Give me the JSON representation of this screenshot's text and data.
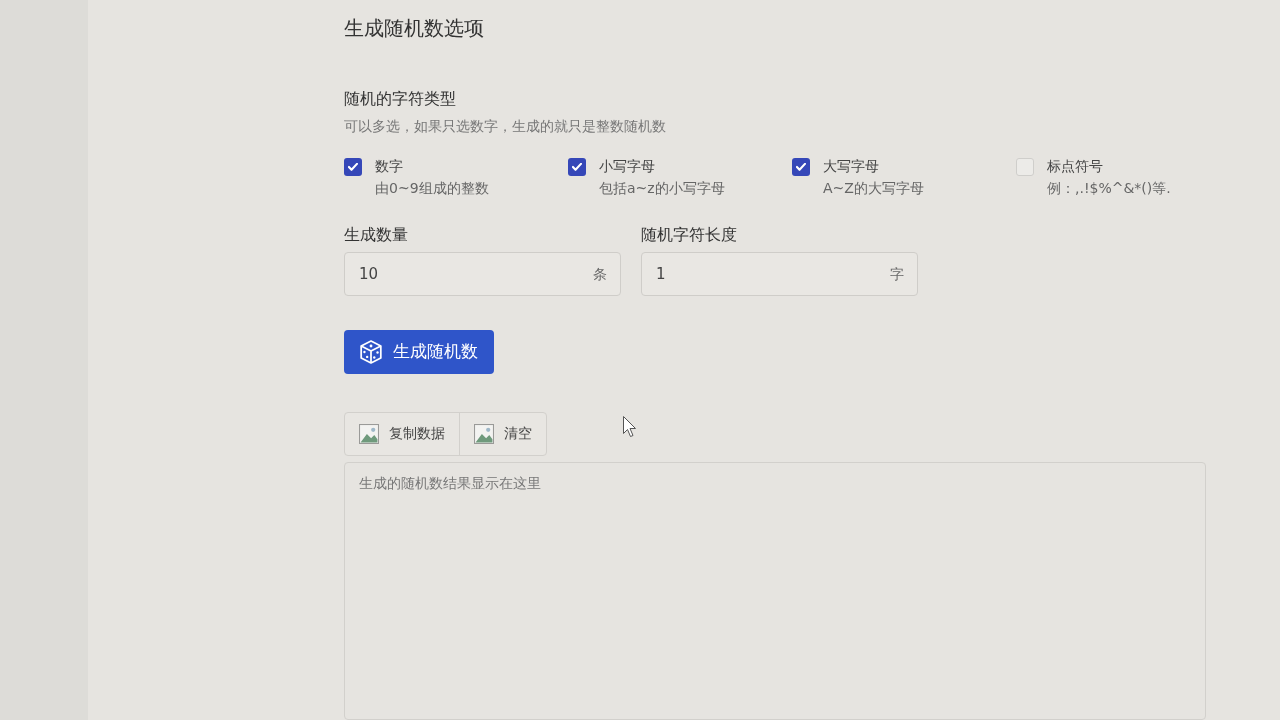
{
  "page": {
    "title": "生成随机数选项"
  },
  "char_types": {
    "label": "随机的字符类型",
    "hint": "可以多选，如果只选数字，生成的就只是整数随机数",
    "options": [
      {
        "label": "数字",
        "description": "由0~9组成的整数",
        "checked": true
      },
      {
        "label": "小写字母",
        "description": "包括a~z的小写字母",
        "checked": true
      },
      {
        "label": "大写字母",
        "description": "A~Z的大写字母",
        "checked": true
      },
      {
        "label": "标点符号",
        "description": "例：,.!$%^&*()等.",
        "checked": false
      }
    ]
  },
  "fields": [
    {
      "label": "生成数量",
      "value": "10",
      "unit": "条"
    },
    {
      "label": "随机字符长度",
      "value": "1",
      "unit": "字"
    }
  ],
  "generate_button": {
    "label": "生成随机数"
  },
  "toolbar": [
    {
      "label": "复制数据"
    },
    {
      "label": "清空"
    }
  ],
  "result": {
    "placeholder": "生成的随机数结果显示在这里"
  }
}
